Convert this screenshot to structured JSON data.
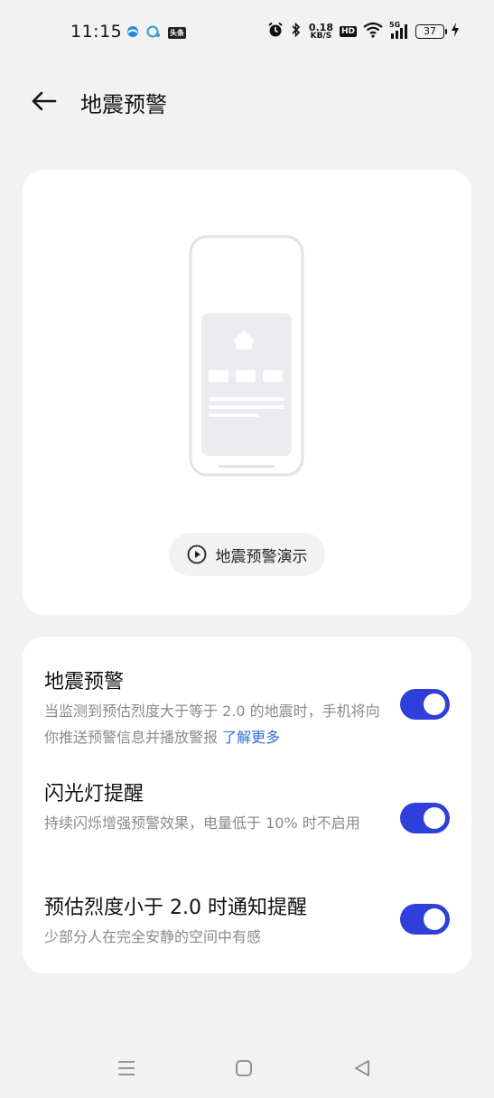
{
  "status_bar": {
    "time": "11:15",
    "left_icons": [
      "cloud-app-icon",
      "chat-app-icon",
      "toutiao-icon"
    ],
    "toutiao_label": "头条",
    "right_icons": [
      "alarm-icon",
      "bluetooth-icon",
      "netspeed",
      "hd-icon",
      "wifi-icon",
      "signal-icon",
      "battery-icon",
      "charging-icon"
    ],
    "netspeed_value": "0.18",
    "netspeed_unit": "KB/S",
    "hd_label": "HD",
    "signal_label": "5G",
    "battery_level": "37"
  },
  "header": {
    "title": "地震预警",
    "back_icon": "arrow-left-icon"
  },
  "illustration": {
    "demo_button_label": "地震预警演示",
    "play_icon": "play-circle-icon"
  },
  "settings": [
    {
      "title": "地震预警",
      "description": "当监测到预估烈度大于等于 2.0 的地震时，手机将向你推送预警信息并播放警报",
      "link_text": "了解更多",
      "enabled": true
    },
    {
      "title": "闪光灯提醒",
      "description": "持续闪烁增强预警效果，电量低于 10% 时不启用",
      "enabled": true
    },
    {
      "title": "预估烈度小于 2.0 时通知提醒",
      "description": "少部分人在完全安静的空间中有感",
      "enabled": true
    }
  ],
  "nav_bar": [
    "menu-icon",
    "home-icon",
    "back-triangle-icon"
  ],
  "colors": {
    "accent": "#2f3fd9",
    "link": "#2f6fd6",
    "background": "#f2f2f2",
    "card": "#ffffff"
  }
}
